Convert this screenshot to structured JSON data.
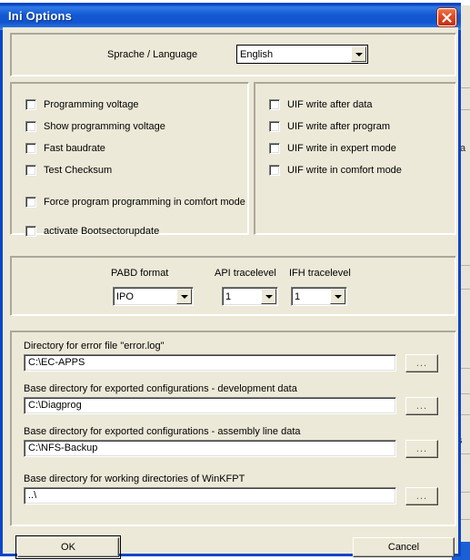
{
  "window": {
    "title": "Ini Options",
    "close_icon": "close-icon",
    "titlebar_color": "#1155d0",
    "close_button_color": "#c22e12",
    "face_color": "#ece9d8",
    "border_color": "#0a46c8"
  },
  "language_group": {
    "label": "Sprache / Language",
    "combo": {
      "value": "English",
      "options": [
        "English"
      ]
    }
  },
  "left_options": {
    "checkboxes": [
      {
        "label": "Programming voltage",
        "checked": false
      },
      {
        "label": "Show programming voltage",
        "checked": false
      },
      {
        "label": "Fast baudrate",
        "checked": false
      },
      {
        "label": "Test Checksum",
        "checked": false
      },
      {
        "label": "Force program programming in comfort mode",
        "checked": false
      },
      {
        "label": "activate Bootsectorupdate",
        "checked": false
      }
    ]
  },
  "right_options": {
    "checkboxes": [
      {
        "label": "UIF write after data",
        "checked": false
      },
      {
        "label": "UIF write after program",
        "checked": false
      },
      {
        "label": "UIF write in expert mode",
        "checked": false
      },
      {
        "label": "UIF write in comfort mode",
        "checked": false
      }
    ]
  },
  "trace_group": {
    "fields": [
      {
        "label": "PABD format",
        "value": "IPO",
        "options": [
          "IPO"
        ]
      },
      {
        "label": "API tracelevel",
        "value": "1",
        "options": [
          "1"
        ]
      },
      {
        "label": "IFH tracelevel",
        "value": "1",
        "options": [
          "1"
        ]
      }
    ]
  },
  "directories": {
    "browse_label": "...",
    "entries": [
      {
        "label": "Directory for error file \"error.log\"",
        "value": "C:\\EC-APPS"
      },
      {
        "label": "Base directory for exported configurations - development data",
        "value": "C:\\Diagprog"
      },
      {
        "label": "Base directory for exported configurations - assembly line data",
        "value": "C:\\NFS-Backup"
      },
      {
        "label": "Base directory for working directories of WinKFPT",
        "value": "..\\"
      }
    ]
  },
  "footer": {
    "ok_label": "OK",
    "cancel_label": "Cancel"
  },
  "background": {
    "fragment_top": "ta",
    "fragment_bottom": "s"
  }
}
